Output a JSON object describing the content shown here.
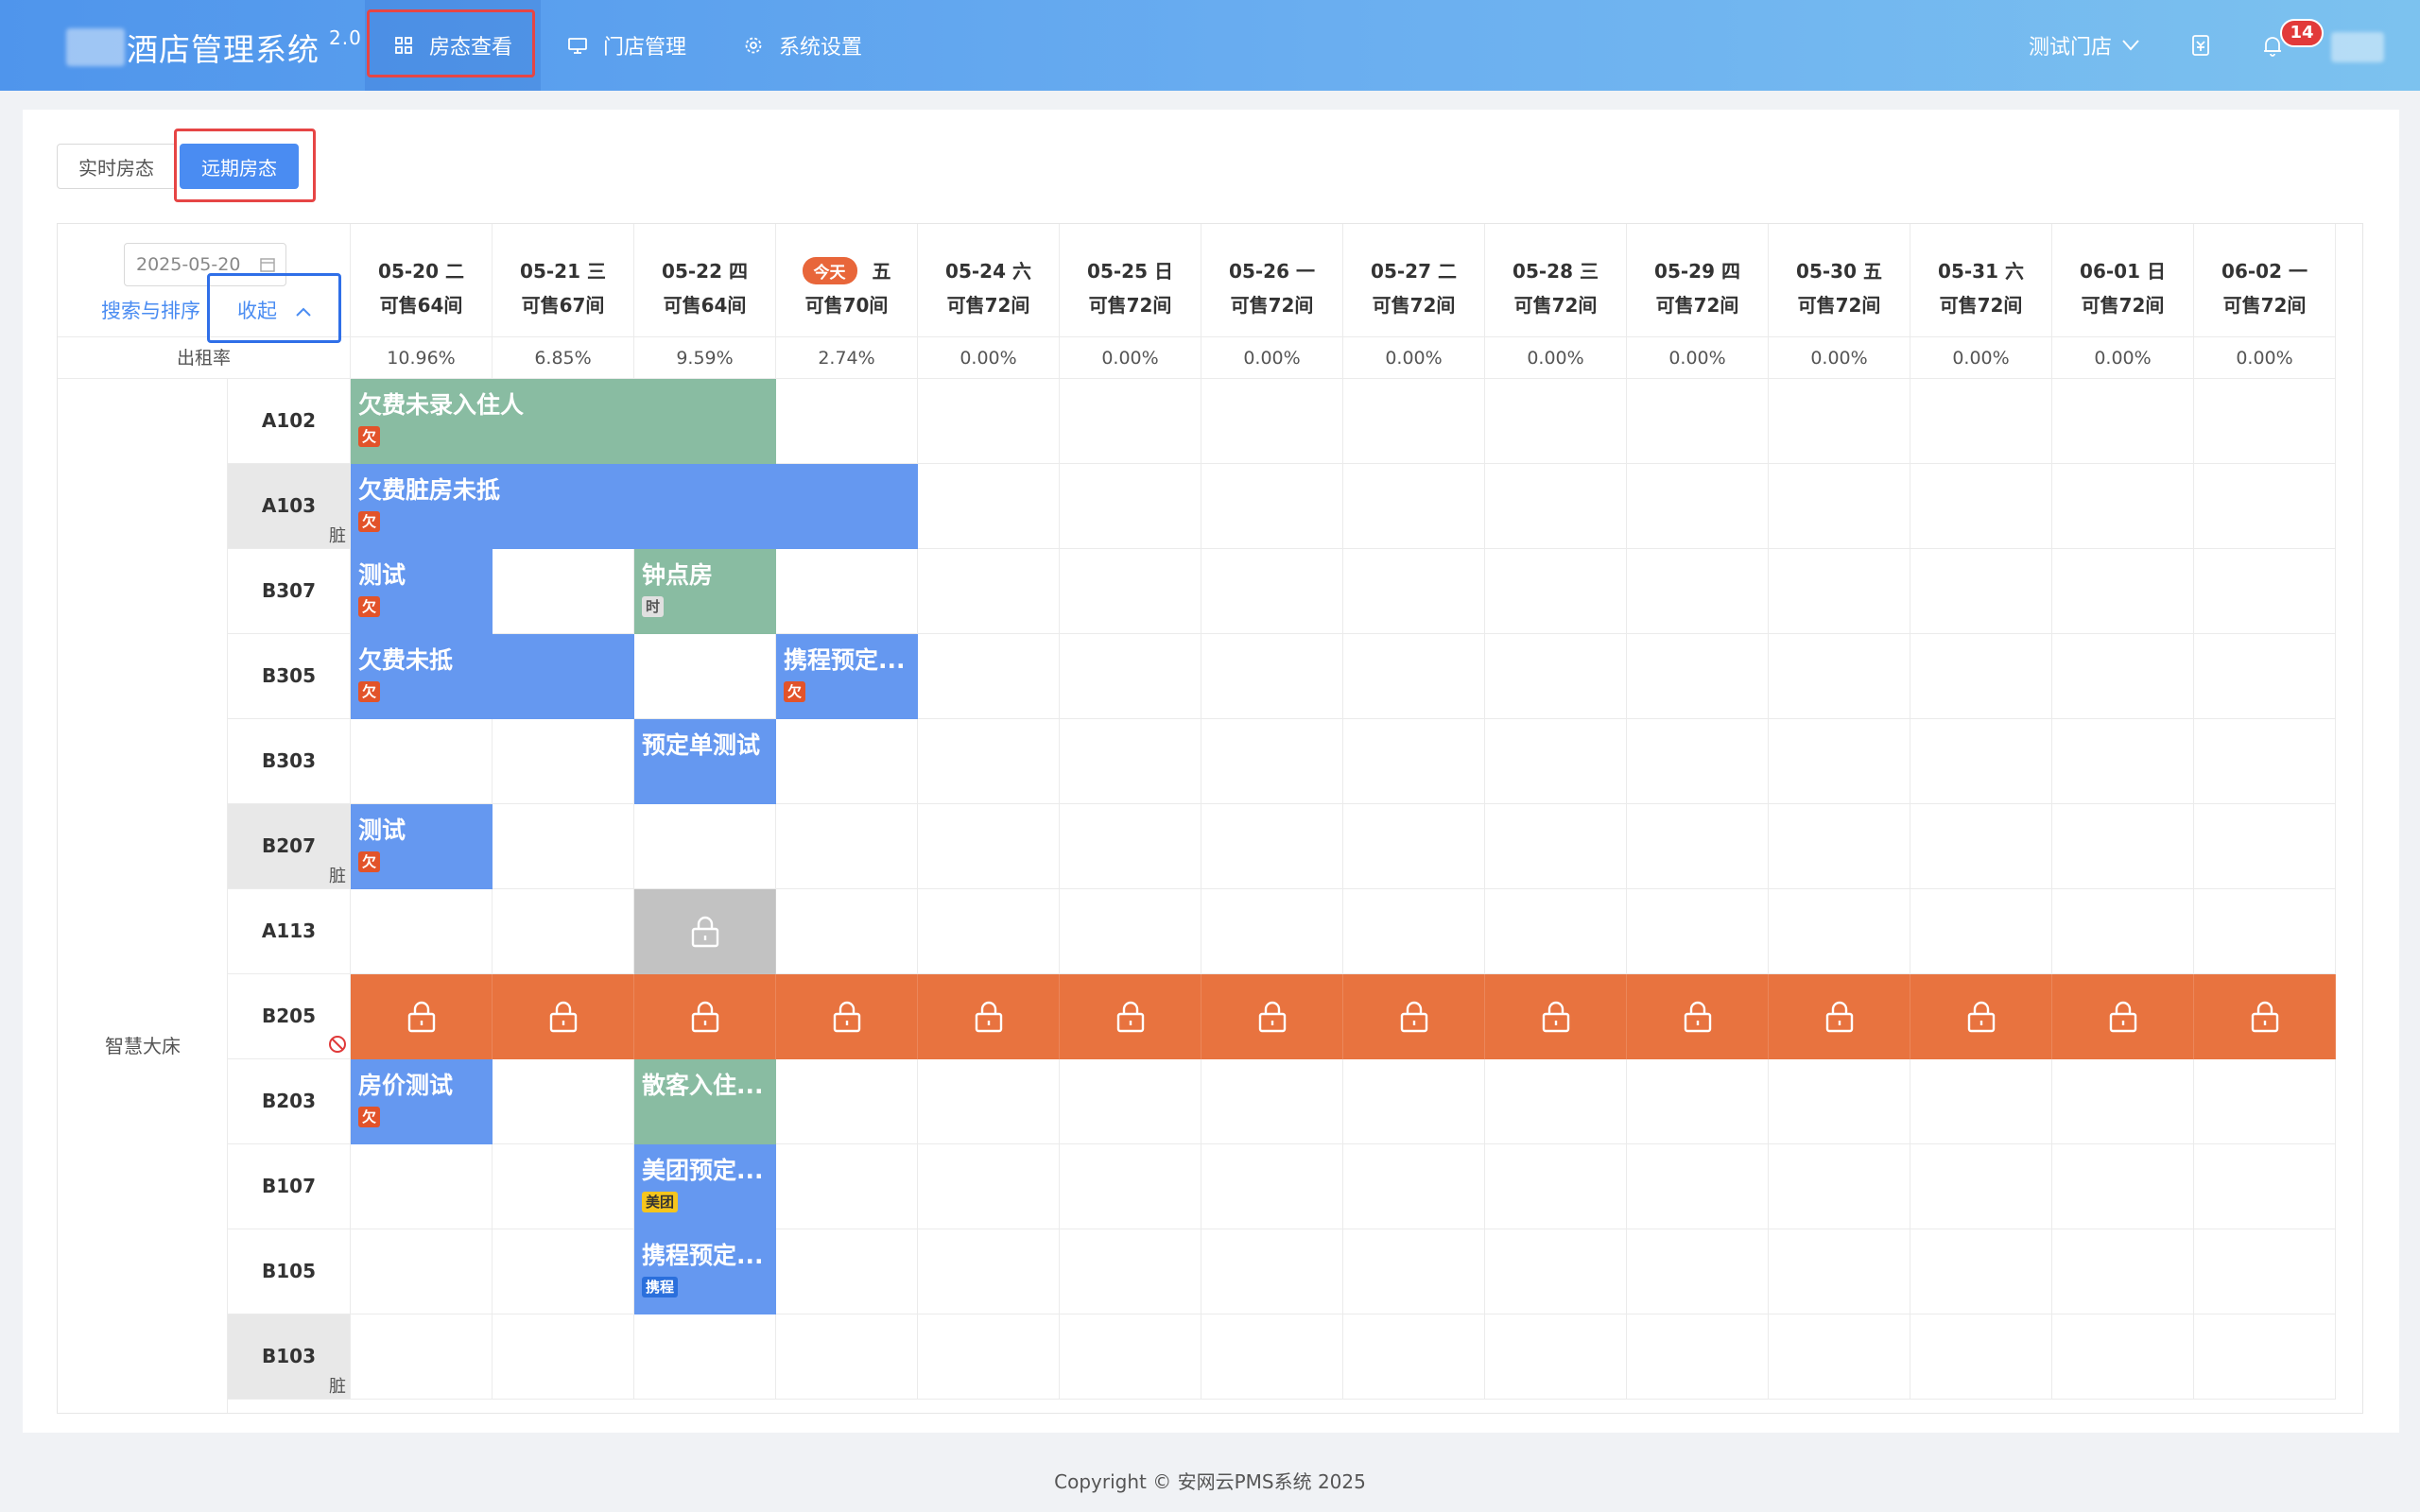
{
  "header": {
    "brand": "酒店管理系统",
    "version": "2.0",
    "nav": [
      {
        "label": "房态查看",
        "icon": "grid-icon"
      },
      {
        "label": "门店管理",
        "icon": "monitor-icon"
      },
      {
        "label": "系统设置",
        "icon": "gear-icon"
      }
    ],
    "store": "测试门店",
    "notification_count": "14"
  },
  "tabs": {
    "realtime": "实时房态",
    "future": "远期房态"
  },
  "toolbar": {
    "date_value": "2025-05-20",
    "search_sort": "搜索与排序",
    "collapse": "收起"
  },
  "today_label": "今天",
  "occupancy_label": "出租率",
  "room_type": "智慧大床",
  "dates": [
    {
      "date": "05-20 二",
      "avail": "可售64间",
      "occ": "10.96%"
    },
    {
      "date": "05-21 三",
      "avail": "可售67间",
      "occ": "6.85%"
    },
    {
      "date": "05-22 四",
      "avail": "可售64间",
      "occ": "9.59%"
    },
    {
      "date": "五",
      "avail": "可售70间",
      "occ": "2.74%",
      "today": true
    },
    {
      "date": "05-24 六",
      "avail": "可售72间",
      "occ": "0.00%"
    },
    {
      "date": "05-25 日",
      "avail": "可售72间",
      "occ": "0.00%"
    },
    {
      "date": "05-26 一",
      "avail": "可售72间",
      "occ": "0.00%"
    },
    {
      "date": "05-27 二",
      "avail": "可售72间",
      "occ": "0.00%"
    },
    {
      "date": "05-28 三",
      "avail": "可售72间",
      "occ": "0.00%"
    },
    {
      "date": "05-29 四",
      "avail": "可售72间",
      "occ": "0.00%"
    },
    {
      "date": "05-30 五",
      "avail": "可售72间",
      "occ": "0.00%"
    },
    {
      "date": "05-31 六",
      "avail": "可售72间",
      "occ": "0.00%"
    },
    {
      "date": "06-01 日",
      "avail": "可售72间",
      "occ": "0.00%"
    },
    {
      "date": "06-02 一",
      "avail": "可售72间",
      "occ": "0.00%"
    }
  ],
  "rooms": [
    {
      "no": "A102",
      "status": ""
    },
    {
      "no": "A103",
      "status": "脏"
    },
    {
      "no": "B307",
      "status": ""
    },
    {
      "no": "B305",
      "status": ""
    },
    {
      "no": "B303",
      "status": ""
    },
    {
      "no": "B207",
      "status": "脏"
    },
    {
      "no": "A113",
      "status": ""
    },
    {
      "no": "B205",
      "status": "",
      "blocked": true
    },
    {
      "no": "B203",
      "status": ""
    },
    {
      "no": "B107",
      "status": ""
    },
    {
      "no": "B105",
      "status": ""
    },
    {
      "no": "B103",
      "status": "脏"
    }
  ],
  "bookings": [
    {
      "room": 0,
      "start": 0,
      "span": 3,
      "title": "欠费未录入住人",
      "chip": "欠",
      "chip_type": "qian",
      "color": "green"
    },
    {
      "room": 1,
      "start": 0,
      "span": 4,
      "title": "欠费脏房未抵",
      "chip": "欠",
      "chip_type": "qian",
      "color": "blue"
    },
    {
      "room": 2,
      "start": 0,
      "span": 1,
      "title": "测试",
      "chip": "欠",
      "chip_type": "qian",
      "color": "blue"
    },
    {
      "room": 2,
      "start": 2,
      "span": 1,
      "title": "钟点房",
      "chip": "时",
      "chip_type": "shi",
      "color": "green"
    },
    {
      "room": 3,
      "start": 0,
      "span": 2,
      "title": "欠费未抵",
      "chip": "欠",
      "chip_type": "qian",
      "color": "blue"
    },
    {
      "room": 3,
      "start": 3,
      "span": 1,
      "title": "携程预定...",
      "chip": "欠",
      "chip_type": "qian",
      "color": "blue"
    },
    {
      "room": 4,
      "start": 2,
      "span": 1,
      "title": "预定单测试",
      "chip": "",
      "chip_type": "",
      "color": "blue"
    },
    {
      "room": 5,
      "start": 0,
      "span": 1,
      "title": "测试",
      "chip": "欠",
      "chip_type": "qian",
      "color": "blue"
    },
    {
      "room": 8,
      "start": 0,
      "span": 1,
      "title": "房价测试",
      "chip": "欠",
      "chip_type": "qian",
      "color": "blue"
    },
    {
      "room": 8,
      "start": 2,
      "span": 1,
      "title": "散客入住...",
      "chip": "",
      "chip_type": "",
      "color": "green"
    },
    {
      "room": 9,
      "start": 2,
      "span": 1,
      "title": "美团预定...",
      "chip": "美团",
      "chip_type": "mt",
      "color": "blue"
    },
    {
      "room": 10,
      "start": 2,
      "span": 1,
      "title": "携程预定...",
      "chip": "携程",
      "chip_type": "xc",
      "color": "blue"
    }
  ],
  "locks": [
    {
      "room": 6,
      "start": 2,
      "span": 1,
      "color": "gray"
    },
    {
      "room": 7,
      "start": 0,
      "span": 14,
      "color": "orange"
    }
  ],
  "footer": "Copyright © 安网云PMS系统 2025"
}
